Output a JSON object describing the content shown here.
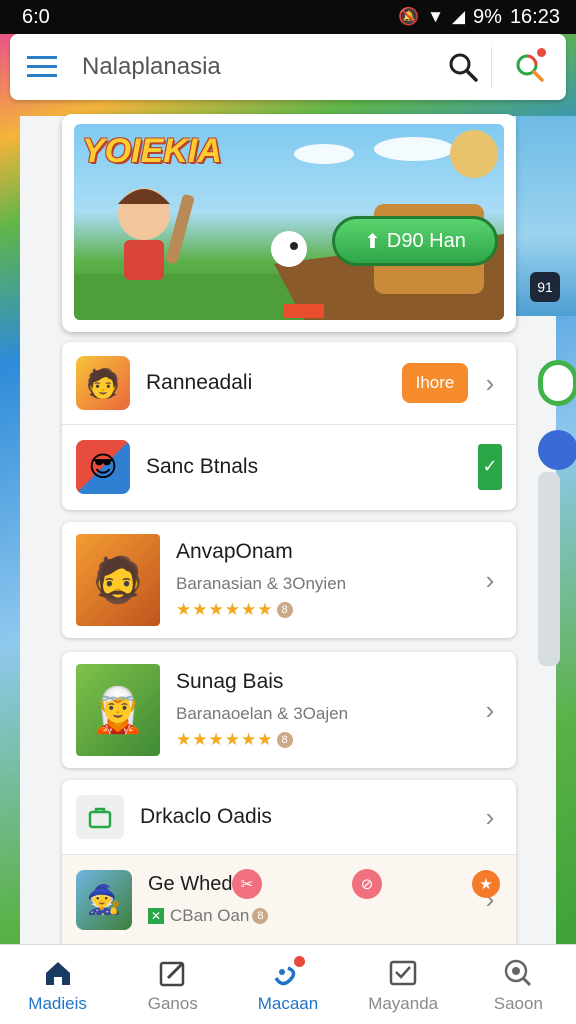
{
  "status_bar": {
    "time": "6:0",
    "battery": "9%",
    "clock": "16:23"
  },
  "app_bar": {
    "title": "Nalaplanasia"
  },
  "banner": {
    "logo_text": "YOIEKIA",
    "play_label": "D90 Han",
    "peek_badge": "91"
  },
  "featured": [
    {
      "title": "Ranneadali",
      "action_label": "Ihore"
    },
    {
      "title": "Sanc Btnals"
    }
  ],
  "games": [
    {
      "title": "AnvapOnam",
      "subtitle": "Baranasian & 3Onyien",
      "rating_badge": "8"
    },
    {
      "title": "Sunag Bais",
      "subtitle": "Baranaoelan & 3Oajen",
      "rating_badge": "8"
    }
  ],
  "downloads": {
    "title": "Drkaclo Oadis",
    "item": {
      "title": "Ge Whed",
      "subtitle": "CBan Oan",
      "sub_badge": "8"
    }
  },
  "bottom_nav": [
    {
      "label": "Madieis",
      "icon": "home-icon",
      "active": true
    },
    {
      "label": "Ganos",
      "icon": "edit-icon"
    },
    {
      "label": "Macaan",
      "icon": "apps-icon",
      "active": true
    },
    {
      "label": "Mayanda",
      "icon": "checkbox-icon"
    },
    {
      "label": "Saoon",
      "icon": "search-icon"
    }
  ],
  "colors": {
    "accent": "#1f74c7",
    "orange": "#f68b2c",
    "green": "#2aa646"
  }
}
